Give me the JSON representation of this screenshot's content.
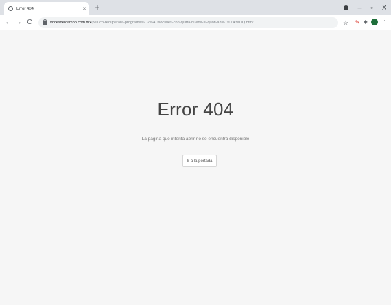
{
  "browser": {
    "tab": {
      "title": "Error 404",
      "close_glyph": "×"
    },
    "new_tab_glyph": "+",
    "window_controls": {
      "minimize": "–",
      "maximize": "▫",
      "close": "X"
    },
    "nav": {
      "back": "←",
      "forward": "→",
      "reload": "C"
    },
    "address": {
      "host": "vocesdelcampo.com.mx",
      "path": "/peluco-recuperara-programa%C2%ADsociales-con-quitta-buena-si-quoti-a3%1%7A3aDQ.htm/"
    },
    "icons": {
      "bookmark_star": "☆",
      "extension_red": "✎",
      "extensions_puzzle": "✱",
      "menu": "⋮"
    }
  },
  "page": {
    "error_title": "Error 404",
    "message": "La pagina que intenta abrir no se encuentra disponible",
    "home_button_label": "Ir a la portada"
  }
}
